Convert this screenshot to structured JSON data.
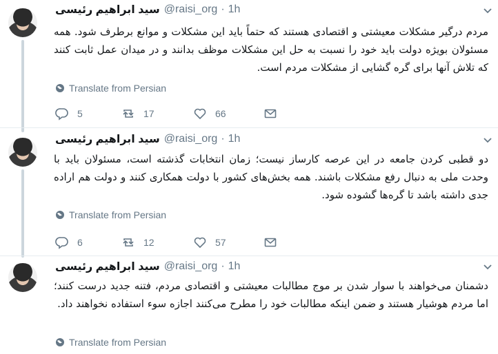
{
  "tweets": [
    {
      "name": "سید ابراهیم رئیسی",
      "handle": "@raisi_org",
      "time": "1h",
      "text": "مردم درگیر مشکلات معیشتی و اقتصادی هستند که حتماً باید این مشکلات و موانع برطرف شود. همه مسئولان بویژه دولت باید خود را نسبت به حل این مشکلات موظف بدانند و در میدان عمل ثابت کنند که تلاش آنها برای گره گشایی از مشکلات مردم است.",
      "translate": "Translate from Persian",
      "replies": "5",
      "retweets": "17",
      "likes": "66"
    },
    {
      "name": "سید ابراهیم رئیسی",
      "handle": "@raisi_org",
      "time": "1h",
      "text": "دو قطبی کردن جامعه در این عرصه کارساز نیست؛ زمان انتخابات گذشته است، مسئولان باید با وحدت ملی به دنبال رفع مشکلات باشند. همه بخش‌های کشور با دولت همکاری کنند و دولت هم اراده جدی داشته باشد تا گره‌ها گشوده شود.",
      "translate": "Translate from Persian",
      "replies": "6",
      "retweets": "12",
      "likes": "57"
    },
    {
      "name": "سید ابراهیم رئیسی",
      "handle": "@raisi_org",
      "time": "1h",
      "text": "دشمنان می‌خواهند با سوار شدن بر موج مطالبات معیشتی و اقتصادی مردم، فتنه جدید درست کنند؛ اما مردم هوشیار هستند و ضمن اینکه مطالبات خود را مطرح می‌کنند اجازه سوء استفاده نخواهند داد.",
      "translate": "Translate from Persian"
    }
  ],
  "colors": {
    "text": "#14171a",
    "secondary": "#657786",
    "thread_line": "#ccd6dd"
  }
}
